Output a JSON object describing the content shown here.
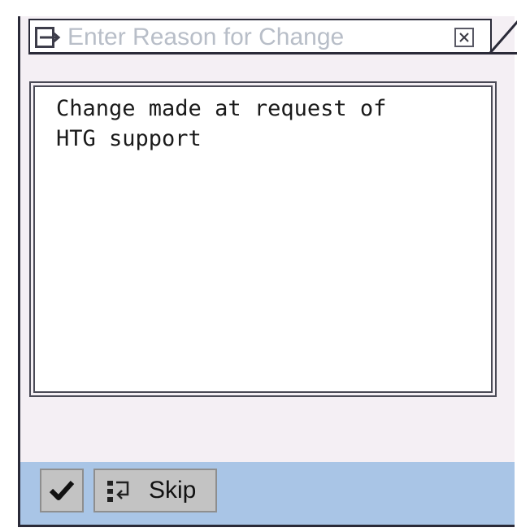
{
  "dialog": {
    "title": "Enter Reason for Change",
    "title_icon": "dialog-arrow-icon",
    "close_icon": "close-icon"
  },
  "reason": {
    "text": "Change made at request of\nHTG support"
  },
  "footer": {
    "ok_icon": "checkmark-icon",
    "skip_icon": "skip-list-icon",
    "skip_label": "Skip"
  },
  "colors": {
    "dialog_background": "#f4eff4",
    "footer_background": "#a9c5e6",
    "title_text": "#b8bec8",
    "border": "#2a2a38",
    "button_face": "#c3c3c3"
  }
}
